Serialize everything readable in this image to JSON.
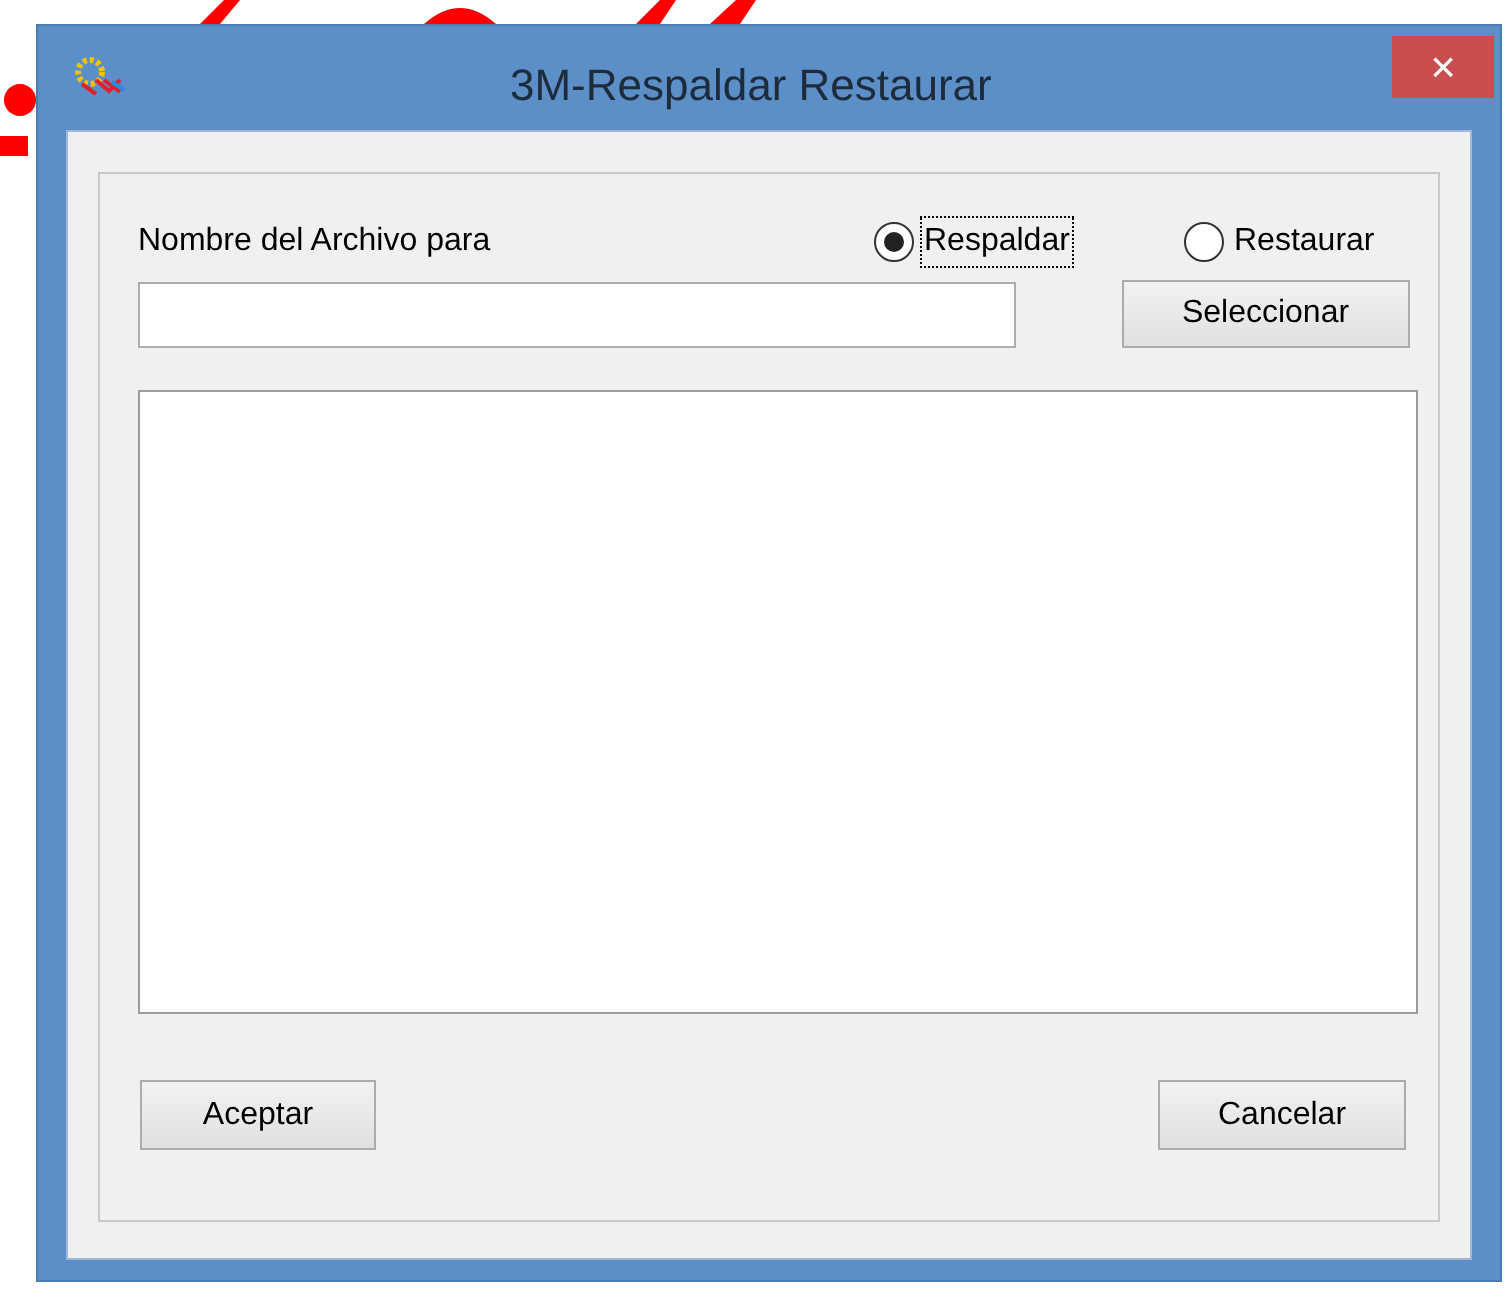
{
  "window": {
    "title": "3M-Respaldar Restaurar",
    "close": "×"
  },
  "label": "Nombre del Archivo para",
  "options": [
    {
      "label": "Respaldar",
      "selected": true,
      "focused": true
    },
    {
      "label": "Restaurar",
      "selected": false,
      "focused": false
    }
  ],
  "select_button": "Seleccionar",
  "buttons": [
    "Aceptar",
    "Cancelar"
  ]
}
